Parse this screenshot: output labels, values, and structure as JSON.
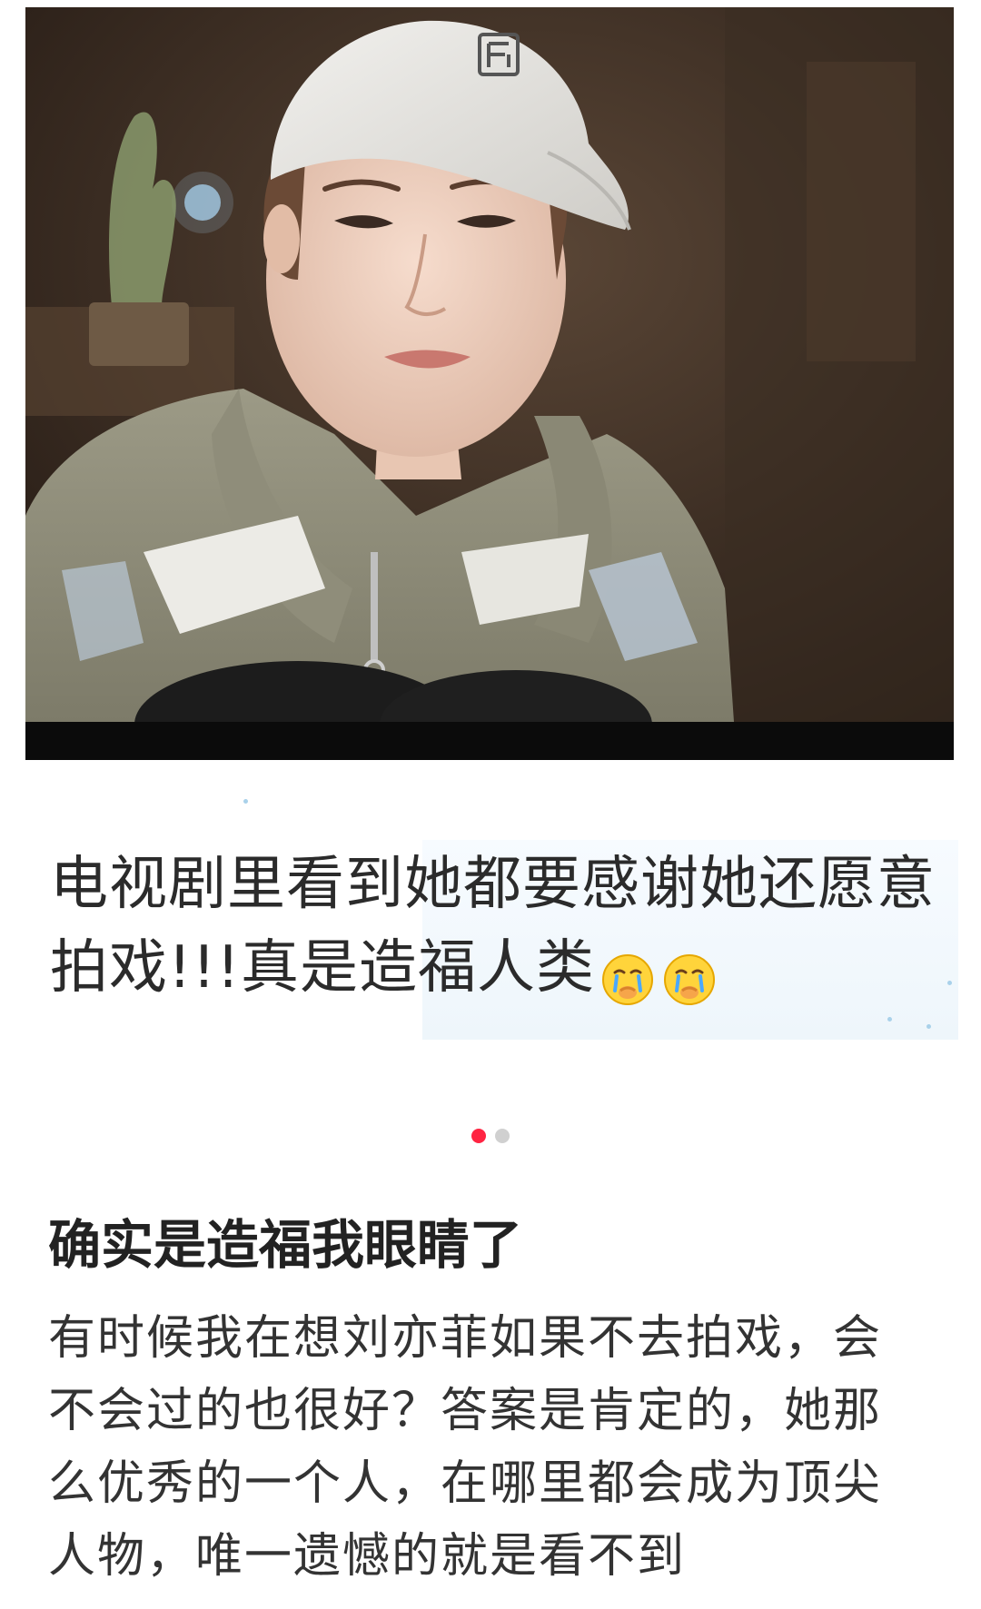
{
  "carousel": {
    "caption": "电视剧里看到她都要感谢她还愿意拍戏!!!真是造福人类",
    "caption_emojis": [
      "crying-face-emoji",
      "crying-face-emoji"
    ],
    "page_count": 2,
    "active_page": 1,
    "active_dot_color": "#ff2442",
    "inactive_dot_color": "#d0d0d0"
  },
  "post": {
    "title": "确实是造福我眼睛了",
    "body": "有时候我在想刘亦菲如果不去拍戏，会不会过的也很好？答案是肯定的，她那么优秀的一个人，在哪里都会成为顶尖人物，唯一遗憾的就是看不到"
  }
}
